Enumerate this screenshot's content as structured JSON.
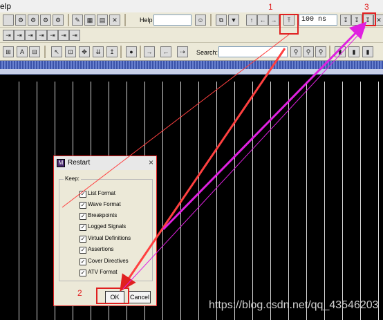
{
  "menubar": {
    "text": "elp"
  },
  "toolbar": {
    "help_label": "Help",
    "help_value": "",
    "time_value": "100 ns",
    "search_label": "Search:",
    "search_value": ""
  },
  "dialog": {
    "title": "Restart",
    "close_glyph": "×",
    "group_label": "Keep:",
    "options": [
      {
        "label": "List Format",
        "checked": true
      },
      {
        "label": "Wave Format",
        "checked": true
      },
      {
        "label": "Breakpoints",
        "checked": true
      },
      {
        "label": "Logged Signals",
        "checked": true
      },
      {
        "label": "Virtual Definitions",
        "checked": true
      },
      {
        "label": "Assertions",
        "checked": true
      },
      {
        "label": "Cover Directives",
        "checked": true
      },
      {
        "label": "ATV Format",
        "checked": true
      }
    ],
    "ok_label": "OK",
    "cancel_label": "Cancel"
  },
  "annotations": {
    "n1": "1",
    "n2": "2",
    "n3": "3"
  },
  "watermark": "https://blog.csdn.net/qq_43546203",
  "colors": {
    "annotation": "#e02020",
    "arrow_magenta": "#e020e0"
  }
}
